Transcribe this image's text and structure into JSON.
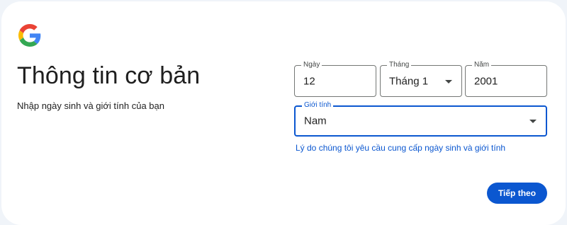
{
  "logo": {
    "icon": "google-g-icon"
  },
  "heading": {
    "title": "Thông tin cơ bản",
    "subtitle": "Nhập ngày sinh và giới tính của bạn"
  },
  "birthdate": {
    "day": {
      "label": "Ngày",
      "value": "12"
    },
    "month": {
      "label": "Tháng",
      "value": "Tháng 1"
    },
    "year": {
      "label": "Năm",
      "value": "2001"
    }
  },
  "gender": {
    "label": "Giới tính",
    "value": "Nam"
  },
  "why_link": "Lý do chúng tôi yêu cầu cung cấp ngày sinh và giới tính",
  "next_button": "Tiếp theo",
  "colors": {
    "accent": "#0b57d0",
    "background": "#f0f4f9",
    "card": "#ffffff",
    "text": "#1f1f1f"
  }
}
